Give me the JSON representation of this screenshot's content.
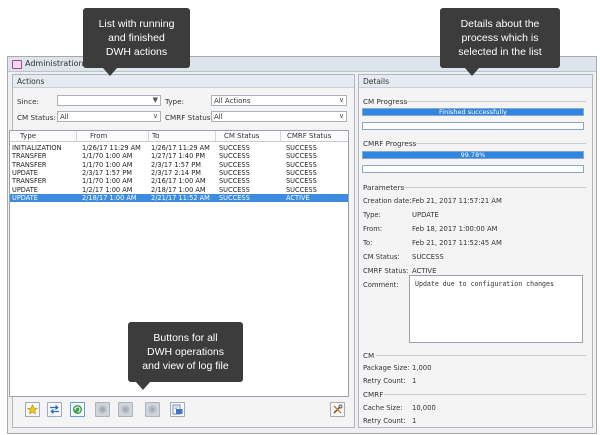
{
  "window": {
    "title": "Administration"
  },
  "actions_panel": {
    "title": "Actions",
    "since_label": "Since:",
    "since_value": "",
    "type_label": "Type:",
    "type_value": "All Actions",
    "cm_status_label": "CM Status:",
    "cm_status_value": "All",
    "cmrf_status_label": "CMRF Status:",
    "cmrf_status_value": "All",
    "table": {
      "columns": [
        "Type",
        "From",
        "To",
        "CM Status",
        "CMRF Status"
      ],
      "rows": [
        [
          "INITIALIZATION",
          "1/26/17 11:29 AM",
          "1/26/17 11:29 AM",
          "SUCCESS",
          "SUCCESS"
        ],
        [
          "TRANSFER",
          "1/1/70 1:00 AM",
          "1/27/17 1:40 PM",
          "SUCCESS",
          "SUCCESS"
        ],
        [
          "TRANSFER",
          "1/1/70 1:00 AM",
          "2/3/17 1:57 PM",
          "SUCCESS",
          "SUCCESS"
        ],
        [
          "UPDATE",
          "2/3/17 1:57 PM",
          "2/3/17 2:14 PM",
          "SUCCESS",
          "SUCCESS"
        ],
        [
          "TRANSFER",
          "1/1/70 1:00 AM",
          "2/16/17 1:00 AM",
          "SUCCESS",
          "SUCCESS"
        ],
        [
          "UPDATE",
          "1/2/17 1:00 AM",
          "2/18/17 1:00 AM",
          "SUCCESS",
          "SUCCESS"
        ],
        [
          "UPDATE",
          "2/18/17 1:00 AM",
          "2/21/17 11:52 AM",
          "SUCCESS",
          "ACTIVE"
        ]
      ],
      "selected_row": 6
    },
    "toolbar": {
      "buttons": [
        "star-icon",
        "transfer-icon",
        "refresh-icon",
        "disabled-action-icon",
        "disabled-action-icon",
        "disabled-action-icon",
        "log-file-icon"
      ],
      "tools_icon": "tools-icon"
    }
  },
  "details_panel": {
    "title": "Details",
    "cm_progress": {
      "label": "CM Progress",
      "text": "Finished successfully",
      "value": 100,
      "secondary_value": 0
    },
    "cmrf_progress": {
      "label": "CMRF Progress",
      "text": "99.78%",
      "value": 99.78,
      "secondary_value": 0
    },
    "parameters": {
      "label": "Parameters",
      "creation_date_label": "Creation date:",
      "creation_date": "Feb 21, 2017 11:57:21 AM",
      "type_label": "Type:",
      "type": "UPDATE",
      "from_label": "From:",
      "from": "Feb 18, 2017 1:00:00 AM",
      "to_label": "To:",
      "to": "Feb 21, 2017 11:52:45 AM",
      "cm_status_label": "CM Status:",
      "cm_status": "SUCCESS",
      "cmrf_status_label": "CMRF Status:",
      "cmrf_status": "ACTIVE",
      "comment_label": "Comment:",
      "comment": "Update due to configuration changes"
    },
    "cm": {
      "label": "CM",
      "package_size_label": "Package Size:",
      "package_size": "1,000",
      "retry_count_label": "Retry Count:",
      "retry_count": "1"
    },
    "cmrf": {
      "label": "CMRF",
      "cache_size_label": "Cache Size:",
      "cache_size": "10,000",
      "retry_count_label": "Retry Count:",
      "retry_count": "1"
    }
  },
  "callouts": {
    "list": [
      "List with running",
      "and finished",
      "DWH actions"
    ],
    "details": [
      "Details about the",
      "process which is",
      "selected in the list"
    ],
    "buttons": [
      "Buttons for all",
      "DWH operations",
      "and view of log file"
    ]
  },
  "colors": {
    "accent": "#2f86e0",
    "selection": "#3d8ce0",
    "callout": "#3c3c3c"
  }
}
